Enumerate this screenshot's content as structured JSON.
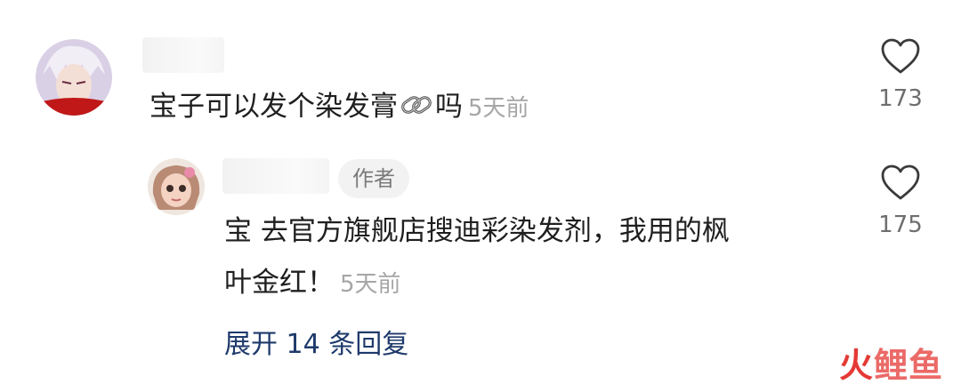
{
  "comments": [
    {
      "text_before_emoji": "宝子可以发个染发膏",
      "emoji": "link-emoji",
      "text_after_emoji": "吗",
      "time": "5天前",
      "likes": "173"
    }
  ],
  "reply": {
    "badge": "作者",
    "line1": "宝 去官方旗舰店搜迪彩染发剂，我用的枫",
    "line2": "叶金红！",
    "time": "5天前",
    "likes": "175"
  },
  "expand_replies": "展开 14 条回复",
  "watermark": {
    "brand": "火",
    "rest": "鲤鱼"
  },
  "colors": {
    "accent_link": "#1e3a6b",
    "watermark": "#e53935"
  }
}
